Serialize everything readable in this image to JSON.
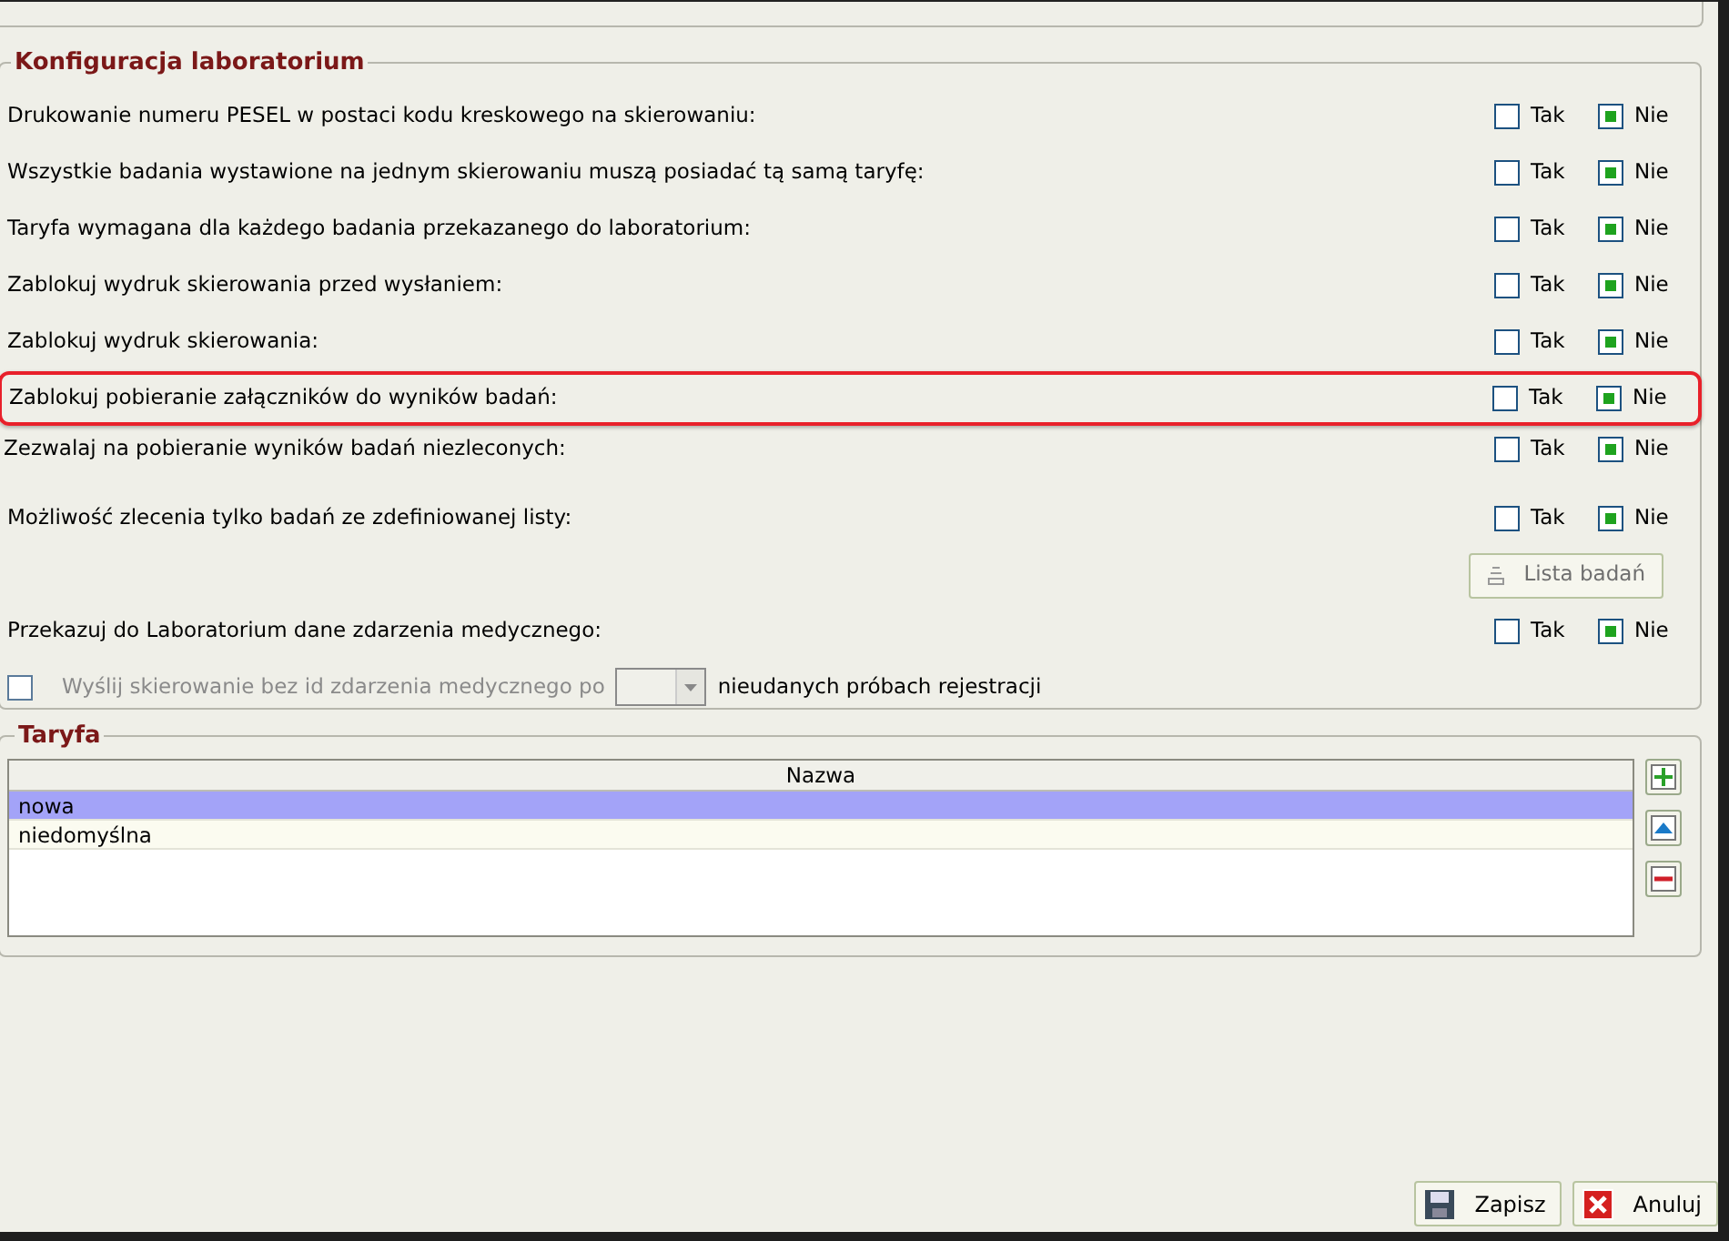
{
  "lab_config": {
    "title": "Konfiguracja laboratorium",
    "rows": [
      {
        "kind": "yesno",
        "label": "Drukowanie numeru PESEL w postaci kodu kreskowego na skierowaniu:",
        "yes_label": "Tak",
        "no_label": "Nie",
        "yes": false,
        "no": true,
        "highlighted": false
      },
      {
        "kind": "yesno",
        "label": "Wszystkie badania wystawione na jednym skierowaniu muszą posiadać tą samą taryfę:",
        "yes_label": "Tak",
        "no_label": "Nie",
        "yes": false,
        "no": true,
        "highlighted": false
      },
      {
        "kind": "yesno",
        "label": "Taryfa wymagana dla każdego badania przekazanego do laboratorium:",
        "yes_label": "Tak",
        "no_label": "Nie",
        "yes": false,
        "no": true,
        "highlighted": false
      },
      {
        "kind": "yesno",
        "label": "Zablokuj wydruk skierowania przed wysłaniem:",
        "yes_label": "Tak",
        "no_label": "Nie",
        "yes": false,
        "no": true,
        "highlighted": false
      },
      {
        "kind": "yesno",
        "label": "Zablokuj wydruk skierowania:",
        "yes_label": "Tak",
        "no_label": "Nie",
        "yes": false,
        "no": true,
        "highlighted": false
      },
      {
        "kind": "yesno",
        "label": "Zablokuj pobieranie załączników do wyników badań:",
        "yes_label": "Tak",
        "no_label": "Nie",
        "yes": false,
        "no": true,
        "highlighted": true
      },
      {
        "kind": "yesno",
        "label": "Zezwalaj na pobieranie wyników badań niezleconych:",
        "yes_label": "Tak",
        "no_label": "Nie",
        "yes": false,
        "no": true,
        "highlighted": false
      },
      {
        "kind": "yesno",
        "label": "Możliwość zlecenia tylko badań ze zdefiniowanej listy:",
        "yes_label": "Tak",
        "no_label": "Nie",
        "yes": false,
        "no": true,
        "highlighted": false
      },
      {
        "kind": "button",
        "label": "Lista badań",
        "disabled": true
      },
      {
        "kind": "yesno",
        "label": "Przekazuj do Laboratorium dane zdarzenia medycznego:",
        "yes_label": "Tak",
        "no_label": "Nie",
        "yes": false,
        "no": true,
        "highlighted": false
      },
      {
        "kind": "retry",
        "label": "Wyślij skierowanie bez id zdarzenia medycznego po",
        "suffix": "nieudanych próbach rejestracji",
        "checked": false,
        "disabled": true
      }
    ]
  },
  "tariff": {
    "title": "Taryfa",
    "columns": [
      "Nazwa"
    ],
    "rows": [
      {
        "name": "nowa",
        "selected": true
      },
      {
        "name": "niedomyślna",
        "selected": false
      }
    ]
  },
  "footer_buttons": [
    {
      "kind": "save",
      "label": "Zapisz"
    },
    {
      "kind": "cancel",
      "label": "Anuluj"
    }
  ]
}
